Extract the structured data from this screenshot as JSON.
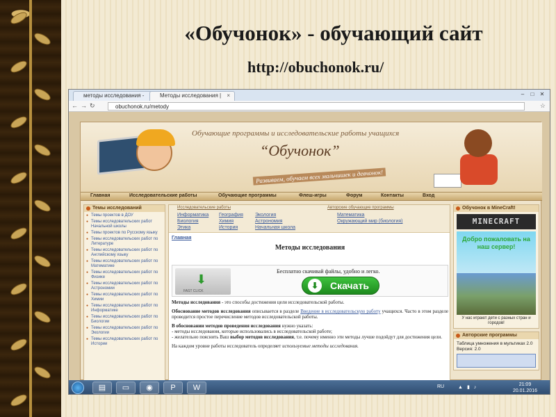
{
  "slide": {
    "title": "«Обучонок» - обучающий сайт",
    "url": "http://obuchonok.ru/"
  },
  "browser": {
    "tabs": [
      {
        "label": "методы исследования - ",
        "active": false
      },
      {
        "label": "Методы исследования | ",
        "active": true
      }
    ],
    "address": "obuchonok.ru/metody"
  },
  "site": {
    "tagline": "Обучающие программы и исследовательские работы учащихся",
    "brand": "“Обучонок”",
    "slogan": "Развиваем, обучаем всех мальчишек и девчонок!",
    "menu": [
      "Главная",
      "Исследовательские работы",
      "Обучающие программы",
      "Флеш-игры",
      "Форум",
      "Контакты",
      "Вход"
    ],
    "left": {
      "title": "Темы исследований",
      "items": [
        "Темы проектов в ДОУ",
        "Темы исследовательских работ Начальной школы",
        "Темы проектов по Русскому языку",
        "Темы исследовательских работ по Литературе",
        "Темы исследовательских работ по Английскому языку",
        "Темы исследовательских работ по Математике",
        "Темы исследовательских работ по Физике",
        "Темы исследовательских работ по Астрономии",
        "Темы исследовательских работ по Химии",
        "Темы исследовательских работ по Информатике",
        "Темы исследовательских работ по Биологии",
        "Темы исследовательских работ по Экологии",
        "Темы исследовательских работ по Истории"
      ]
    },
    "center": {
      "research_header": "Исследовательские работы",
      "programs_header": "Авторские обучающие программы",
      "links": {
        "informatika": "Информатика",
        "geografiya": "География",
        "ekologiya": "Экология",
        "matematika": "Математика",
        "biologiya": "Биология",
        "khimiya": "Химия",
        "astronomiya": "Астрономия",
        "okruzhayushchiy": "Окружающий мир (биология)",
        "etika": "Этика",
        "istoriya": "История",
        "nachalnaya": "Начальная школа"
      },
      "breadcrumb": "Главная",
      "page_title": "Методы исследования",
      "download_caption": "Бесплатно скачивай файлы, удобно и легко.",
      "download_button": "Скачать",
      "download_icon_caption": "FAST CLICK",
      "p1_bold": "Методы исследования",
      "p1_rest": " - это способы достижения цели исследовательской работы.",
      "p2_bold": "Обоснование методов исследования",
      "p2_mid": " описывается в разделе ",
      "p2_link": "Введение в исследовательскую работу",
      "p2_rest": " учащихся. Часто в этом разделе проводится простое перечисление методов исследовательской работы.",
      "p3_bold": "В обосновании методов проведения исследования",
      "p3_rest": " нужно указать:",
      "p3_line1": "- методы исследования, которые использовались в исследовательской работе;",
      "p3_line2a": "- желательно пояснить Ваш ",
      "p3_line2b": "выбор методов исследования",
      "p3_line2c": ", т.е. почему именно эти методы лучше подойдут для достижения цели.",
      "p4": "На каждом уровне работы исследователь определяет ",
      "p4_italic": "используемые методы исследования."
    },
    "right": {
      "mc_title": "Обучонок в MineCraft!",
      "mc_logo": "MINECRAFT",
      "mc_welcome": "Добро пожаловать на наш сервер!",
      "mc_caption": "У нас играют дети с разных стран и городов!",
      "prog_title": "Авторские программы",
      "prog_name": "Таблица умножения в мультиках 2.0",
      "prog_version": "Версия: 2.0"
    }
  },
  "taskbar": {
    "lang": "RU",
    "time": "21:09",
    "date": "20.01.2016"
  }
}
